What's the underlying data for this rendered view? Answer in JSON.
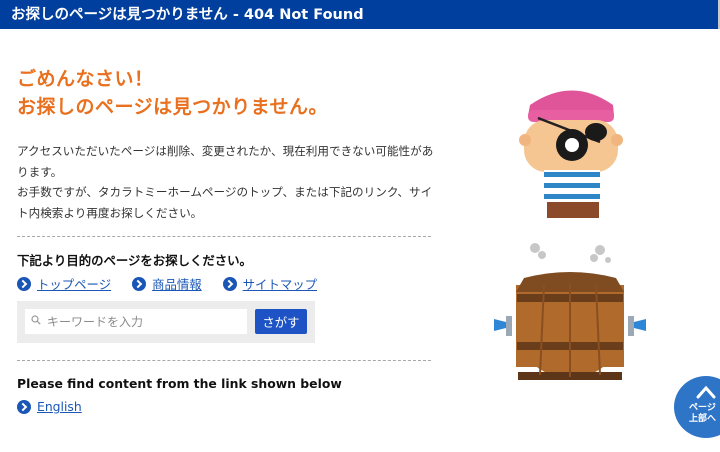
{
  "title_bar": "お探しのページは見つかりません - 404 Not Found",
  "headline": {
    "line1": "ごめんなさい！",
    "line2": "お探しのページは見つかりません。"
  },
  "description": {
    "p1": "アクセスいただいたページは削除、変更されたか、現在利用できない可能性があります。",
    "p2": "お手数ですが、タカラトミーホームページのトップ、または下記のリンク、サイト内検索より再度お探しください。"
  },
  "jp_section": {
    "title": "下記より目的のページをお探しください。",
    "links": [
      "トップページ",
      "商品情報",
      "サイトマップ"
    ]
  },
  "search": {
    "placeholder": "キーワードを入力",
    "button": "さがす"
  },
  "en_section": {
    "title": "Please find content from the link shown below",
    "link": "English"
  },
  "page_top": {
    "line1": "ページ",
    "line2": "上部へ"
  },
  "colors": {
    "title_bar": "#003f9e",
    "accent_orange": "#e8701e",
    "link_blue": "#1a57b8",
    "button_blue": "#1d53c4"
  }
}
